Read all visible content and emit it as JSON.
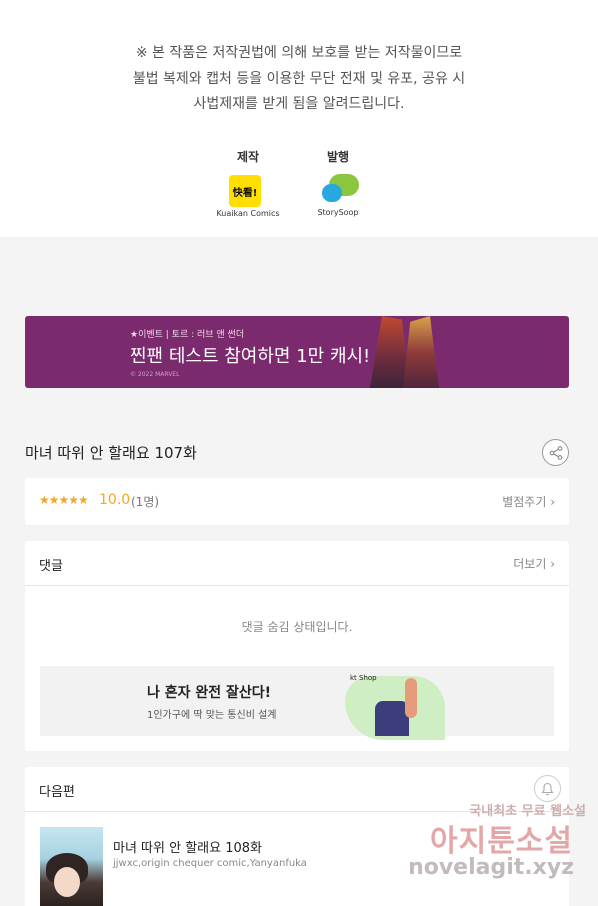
{
  "copyright": {
    "notice_lines": [
      "※ 본 작품은 저작권법에 의해 보호를 받는 저작물이므로",
      "불법 복제와 캡처 등을 이용한 무단 전재 및 유포, 공유 시",
      "사법제재를 받게 됨을 알려드립니다."
    ],
    "producer_label": "제작",
    "producer_name": "Kuaikan Comics",
    "producer_logo_text": "快看!",
    "publisher_label": "발행",
    "publisher_name": "StorySoop"
  },
  "banner": {
    "subtitle": "★이벤트 | 토르 : 러브 앤 썬더",
    "headline": "찐팬 테스트 참여하면 1만 캐시!",
    "copyright": "© 2022 MARVEL"
  },
  "episode": {
    "title": "마녀 따위 안 할래요 107화",
    "share_icon": "share-icon"
  },
  "rating": {
    "stars": "★★★★★",
    "score": "10.0",
    "count": "(1명)",
    "action_label": "별점주기 ›"
  },
  "comments": {
    "title": "댓글",
    "more_label": "더보기 ›",
    "hidden_message": "댓글 숨김 상태입니다."
  },
  "ad": {
    "brand": "kt Shop",
    "title": "나 혼자 완전 잘산다!",
    "subtitle": "1인가구에 딱 맞는 통신비 설계"
  },
  "next_episode": {
    "section_title": "다음편",
    "bell_icon": "bell-icon",
    "title": "마녀 따위 안 할래요 108화",
    "authors": "jjwxc,origin chequer comic,Yanyanfuka"
  },
  "watermark": {
    "line1": "국내최초 무료 웹소설",
    "line2": "아지툰소설",
    "line3": "novelagit.xyz"
  },
  "colors": {
    "accent_star": "#f5a623",
    "banner_bg": "#7b2a6e",
    "kakao_yellow": "#ffde00"
  }
}
